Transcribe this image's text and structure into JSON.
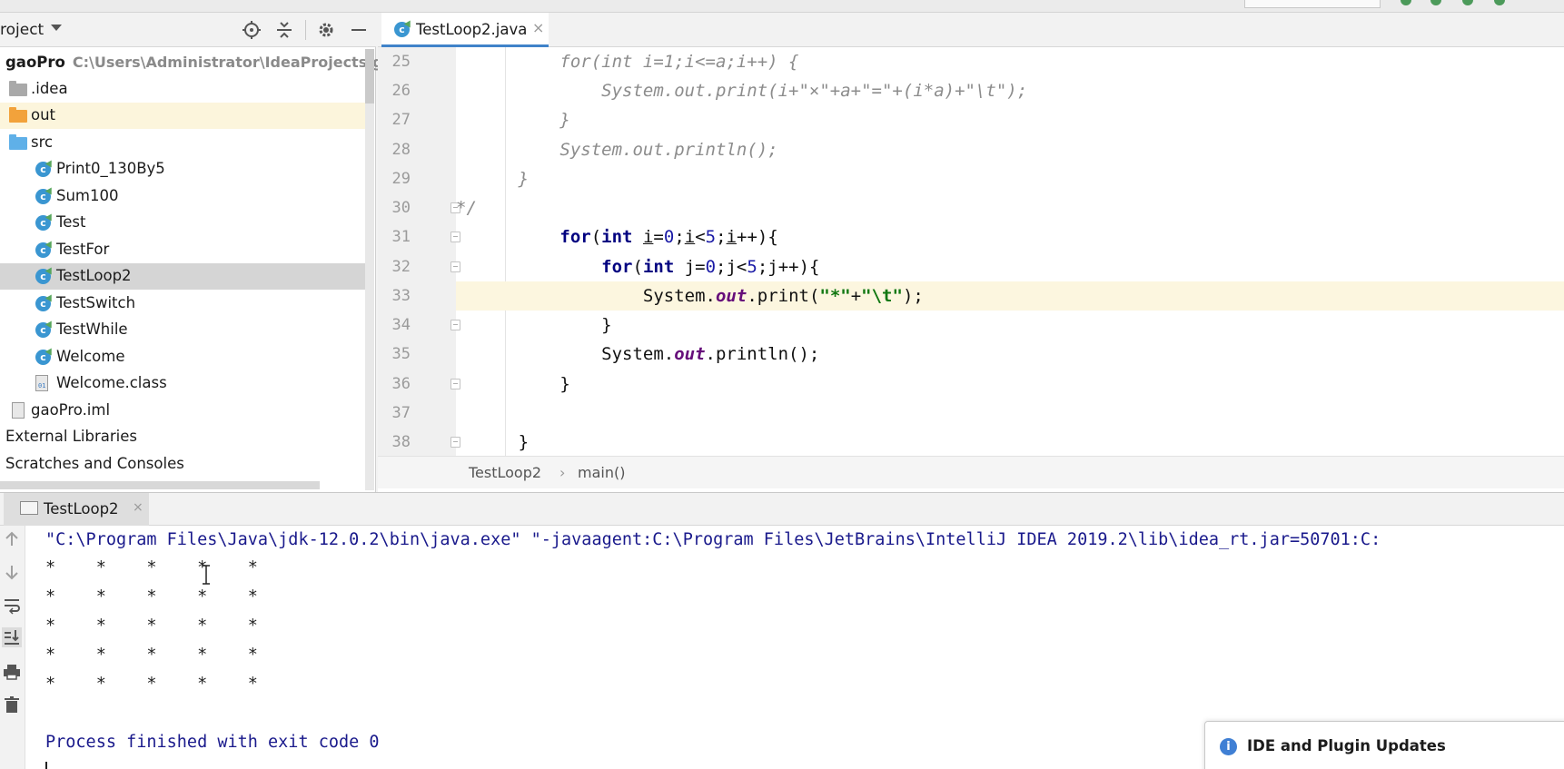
{
  "project_panel": {
    "title": "roject",
    "tree": [
      {
        "label": "gaoPro",
        "path": "C:\\Users\\Administrator\\IdeaProjects\\gao",
        "icon": "module-icon"
      },
      {
        "label": ".idea",
        "icon": "folder-icon"
      },
      {
        "label": "out",
        "icon": "folder-icon"
      },
      {
        "label": "src",
        "icon": "folder-icon"
      },
      {
        "label": "Print0_130By5",
        "icon": "class-icon"
      },
      {
        "label": "Sum100",
        "icon": "class-icon"
      },
      {
        "label": "Test",
        "icon": "class-icon"
      },
      {
        "label": "TestFor",
        "icon": "class-icon"
      },
      {
        "label": "TestLoop2",
        "icon": "class-icon"
      },
      {
        "label": "TestSwitch",
        "icon": "class-icon"
      },
      {
        "label": "TestWhile",
        "icon": "class-icon"
      },
      {
        "label": "Welcome",
        "icon": "class-icon"
      },
      {
        "label": "Welcome.class",
        "icon": "class-file-icon"
      },
      {
        "label": "gaoPro.iml",
        "icon": "iml-file-icon"
      },
      {
        "label": "External Libraries",
        "icon": "library-icon"
      },
      {
        "label": "Scratches and Consoles",
        "icon": "scratches-icon"
      }
    ]
  },
  "editor": {
    "tab_label": "TestLoop2.java",
    "tab_close": "×",
    "line_numbers": [
      "25",
      "26",
      "27",
      "28",
      "29",
      "30",
      "31",
      "32",
      "33",
      "34",
      "35",
      "36",
      "37",
      "38"
    ],
    "breadcrumb": [
      "TestLoop2",
      "main()"
    ],
    "breadcrumb_sep": "›"
  },
  "run_panel": {
    "tab_label": "TestLoop2",
    "tab_close": "×",
    "command": "\"C:\\Program Files\\Java\\jdk-12.0.2\\bin\\java.exe\" \"-javaagent:C:\\Program Files\\JetBrains\\IntelliJ IDEA 2019.2\\lib\\idea_rt.jar=50701:C:",
    "output_rows": [
      "*    *    *    *    *",
      "*    *    *    *    *",
      "*    *    *    *    *",
      "*    *    *    *    *",
      "*    *    *    *    *"
    ],
    "exit_message": "Process finished with exit code 0"
  },
  "notification": {
    "title": "IDE and Plugin Updates",
    "icon": "i"
  },
  "colors": {
    "accent": "#4083c9",
    "keyword": "#000080",
    "string": "#117711",
    "number": "#1a1aa6",
    "comment": "#8c8c8c",
    "field": "#660e7a",
    "console_text": "#1a1a8c"
  }
}
